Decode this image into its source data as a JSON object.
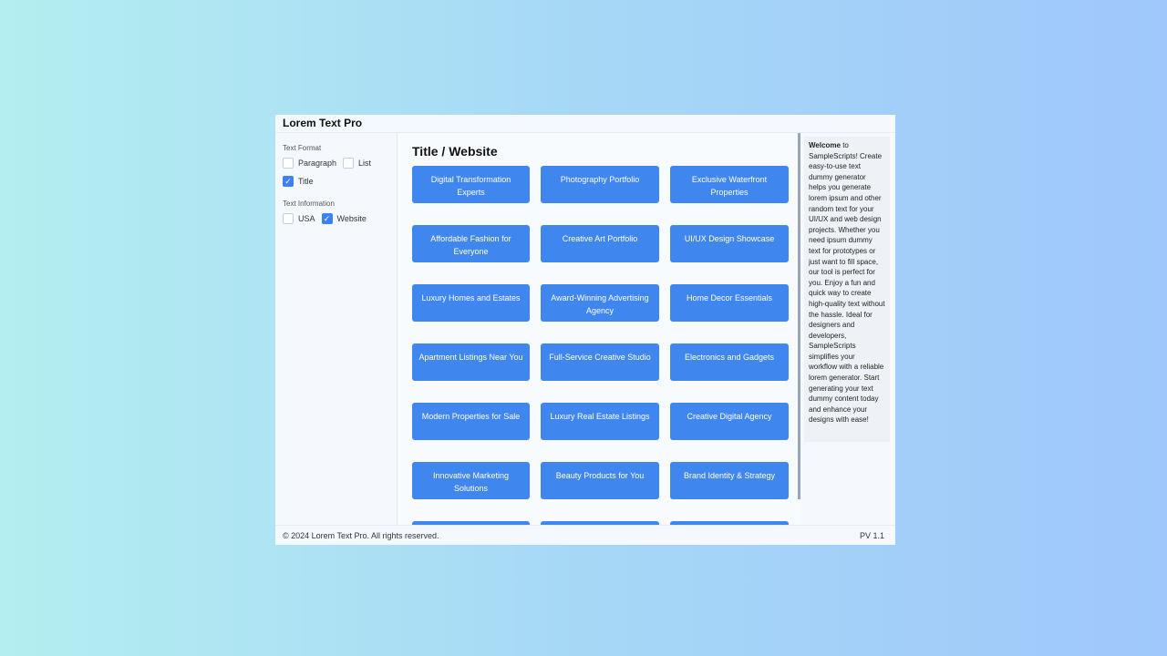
{
  "app": {
    "title": "Lorem Text Pro"
  },
  "sidebar": {
    "format_title": "Text Format",
    "format_options": [
      {
        "label": "Paragraph",
        "checked": false
      },
      {
        "label": "List",
        "checked": false
      },
      {
        "label": "Title",
        "checked": true
      }
    ],
    "info_title": "Text Information",
    "info_options": [
      {
        "label": "USA",
        "checked": false
      },
      {
        "label": "Website",
        "checked": true
      }
    ]
  },
  "main": {
    "heading": "Title / Website",
    "cards": [
      "Digital Transformation Experts",
      "Photography Portfolio",
      "Exclusive Waterfront Properties",
      "Affordable Fashion for Everyone",
      "Creative Art Portfolio",
      "UI/UX Design Showcase",
      "Luxury Homes and Estates",
      "Award-Winning Advertising Agency",
      "Home Decor Essentials",
      "Apartment Listings Near You",
      "Full-Service Creative Studio",
      "Electronics and Gadgets",
      "Modern Properties for Sale",
      "Luxury Real Estate Listings",
      "Creative Digital Agency",
      "Innovative Marketing Solutions",
      "Beauty Products for You",
      "Brand Identity & Strategy",
      "",
      "",
      ""
    ]
  },
  "info": {
    "welcome": "Welcome",
    "text": " to SampleScripts! Create easy-to-use text dummy generator helps you generate lorem ipsum and other random text for your UI/UX and web design projects. Whether you need ipsum dummy text for prototypes or just want to fill space, our tool is perfect for you. Enjoy a fun and quick way to create high-quality text without the hassle. Ideal for designers and developers, SampleScripts simplifies your workflow with a reliable lorem generator. Start generating your text dummy content today and enhance your designs with ease!"
  },
  "footer": {
    "copyright": "© 2024 Lorem Text Pro. All rights reserved.",
    "version": "PV 1.1"
  },
  "colors": {
    "accent": "#3f86ef",
    "checkbox": "#3b82f6"
  }
}
